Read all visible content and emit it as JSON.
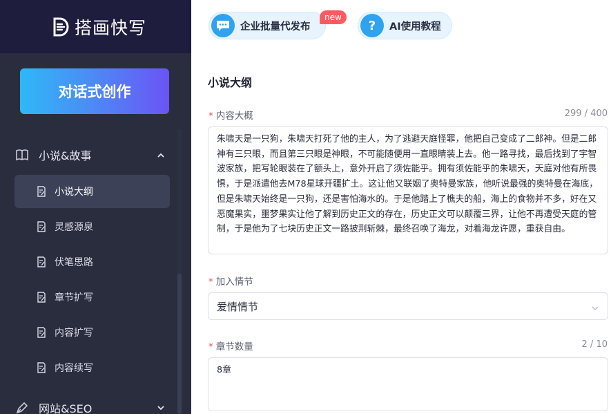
{
  "brand": {
    "name": "搭画快写"
  },
  "cta": {
    "label": "对话式创作"
  },
  "sidebar": {
    "group1": {
      "label": "小说&故事",
      "icon": "book-icon"
    },
    "items": [
      {
        "label": "小说大纲",
        "icon": "document-edit-icon",
        "active": true
      },
      {
        "label": "灵感源泉",
        "icon": "document-edit-icon"
      },
      {
        "label": "伏笔思路",
        "icon": "document-edit-icon"
      },
      {
        "label": "章节扩写",
        "icon": "document-edit-icon"
      },
      {
        "label": "内容扩写",
        "icon": "document-edit-icon"
      },
      {
        "label": "内容续写",
        "icon": "document-edit-icon"
      }
    ],
    "group2": {
      "label": "网站&SEO",
      "icon": "pen-icon"
    }
  },
  "topbar": {
    "batch": {
      "label": "企业批量代发布",
      "icon": "chat-bubble-icon",
      "badge": "new"
    },
    "tutorial": {
      "label": "AI使用教程",
      "icon": "question-icon",
      "icon_glyph": "?"
    }
  },
  "main": {
    "title": "小说大纲",
    "summary": {
      "label": "内容大概",
      "counter": "299 / 400",
      "value": "朱啸天是一只狗，朱啸天打死了他的主人，为了逃避天庭怪罪，他把自己变成了二郎神。但是二郎神有三只眼，而且第三只眼是神眼，不可能随便用一直眼睛装上去。他一路寻找，最后找到了宇智波家族，把写轮眼装在了额头上，意外开启了须佐能乎。拥有须佐能乎的朱啸天，天庭对他有所畏惧，于是派遣他去M78星球开疆扩土。这让他又联姻了奥特曼家族，他听说最强的奥特曼在海底，但是朱啸天始终是一只狗，还是害怕海水的。于是他踏上了樵夫的船，海上的食物并不多，好在又恶魔果实，噩梦果实让他了解到历史正文的存在，历史正文可以颠覆三界，让他不再遭受天庭的管制，于是他为了七块历史正文一路披荆斩棘，最终召唤了海龙，对着海龙许愿，重获自由。"
    },
    "plot": {
      "label": "加入情节",
      "value": "爱情情节"
    },
    "chapters": {
      "label": "章节数量",
      "counter": "2 / 10",
      "value": "8章"
    }
  },
  "colors": {
    "sidebar_bg": "#292d3e",
    "sidebar_top_bg": "#1e1d3d",
    "cta_gradient_start": "#2eb8f7",
    "cta_gradient_end": "#6b54f5",
    "accent_blue": "#2fa3f0",
    "required_red": "#f04a4a",
    "badge_red": "#ff5a5f"
  }
}
